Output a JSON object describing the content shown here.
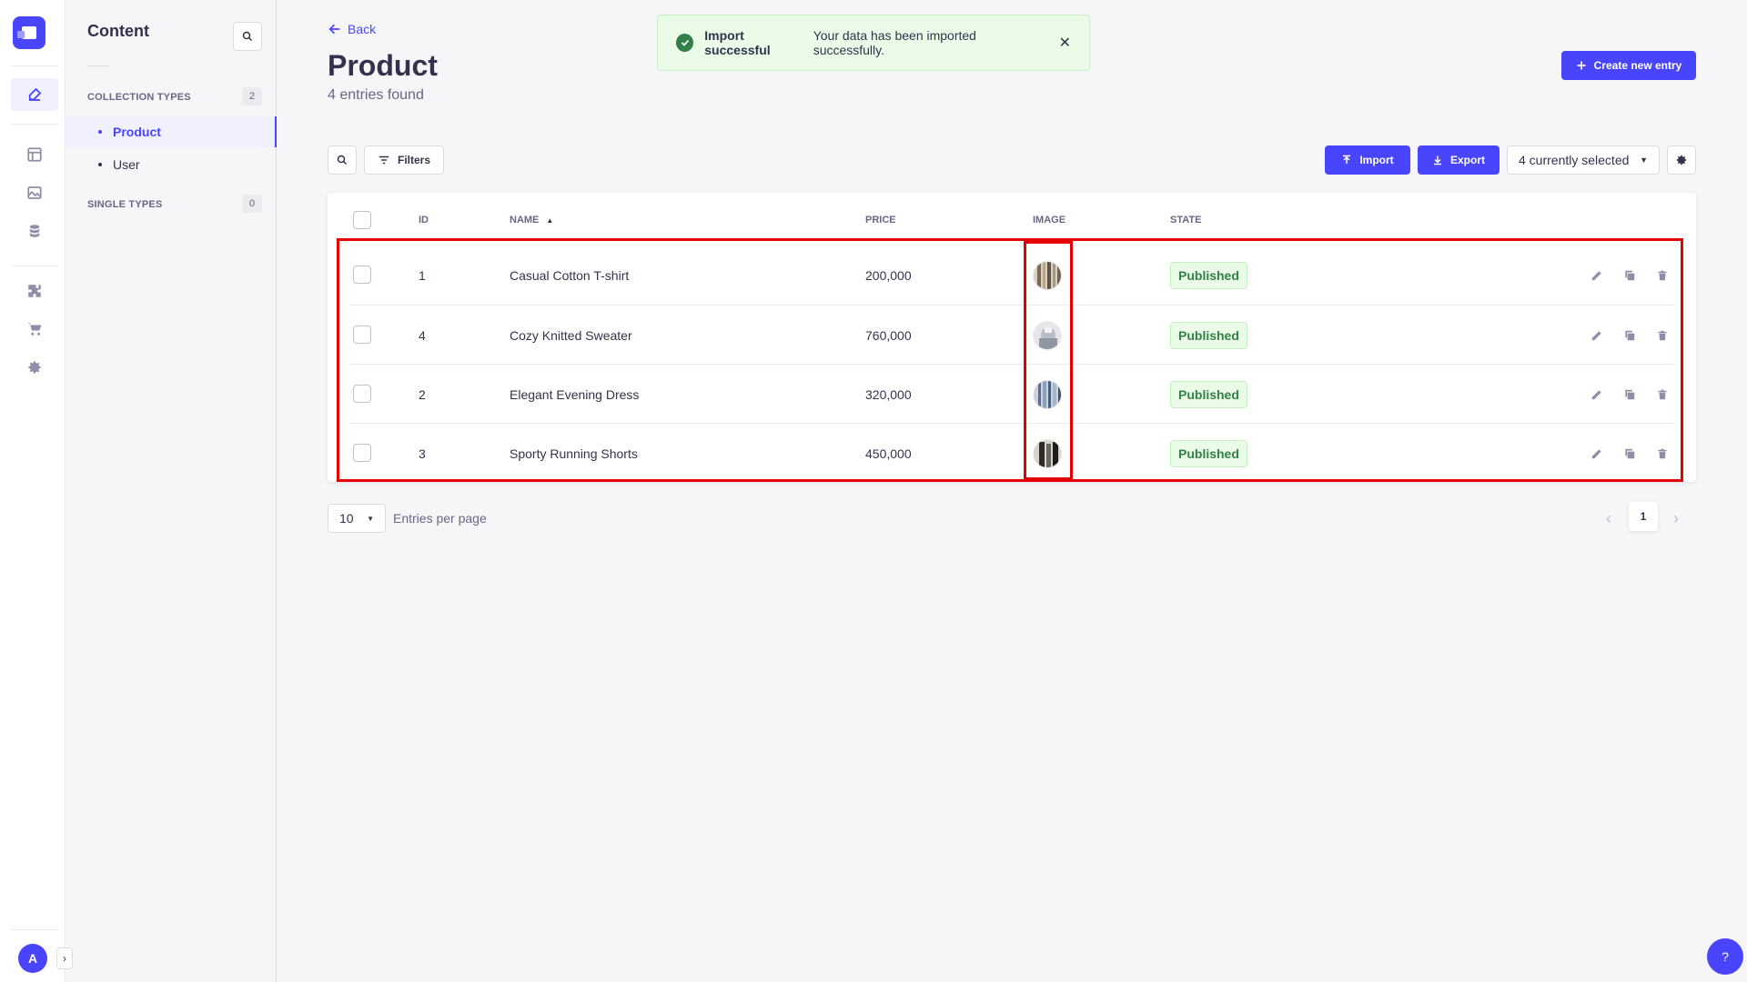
{
  "rail": {
    "avatar_initial": "A"
  },
  "subnav": {
    "title": "Content",
    "collection_types_label": "COLLECTION TYPES",
    "collection_types_count": "2",
    "items": [
      {
        "label": "Product"
      },
      {
        "label": "User"
      }
    ],
    "single_types_label": "SINGLE TYPES",
    "single_types_count": "0"
  },
  "header": {
    "back_label": "Back",
    "title": "Product",
    "subtitle": "4 entries found",
    "create_label": "Create new entry"
  },
  "toast": {
    "title": "Import successful",
    "message": "Your data has been imported successfully."
  },
  "toolbar": {
    "filters_label": "Filters",
    "import_label": "Import",
    "export_label": "Export",
    "columns_selected": "4 currently selected"
  },
  "table": {
    "headers": {
      "id": "ID",
      "name": "NAME",
      "price": "PRICE",
      "image": "IMAGE",
      "state": "STATE"
    },
    "rows": [
      {
        "id": "1",
        "name": "Casual Cotton T-shirt",
        "price": "200,000",
        "state": "Published"
      },
      {
        "id": "4",
        "name": "Cozy Knitted Sweater",
        "price": "760,000",
        "state": "Published"
      },
      {
        "id": "2",
        "name": "Elegant Evening Dress",
        "price": "320,000",
        "state": "Published"
      },
      {
        "id": "3",
        "name": "Sporty Running Shorts",
        "price": "450,000",
        "state": "Published"
      }
    ]
  },
  "pagination": {
    "per_page": "10",
    "per_page_label": "Entries per page",
    "current_page": "1"
  },
  "colors": {
    "primary": "#4945ff",
    "success": "#328048",
    "highlight": "#e60000"
  },
  "help_label": "?"
}
